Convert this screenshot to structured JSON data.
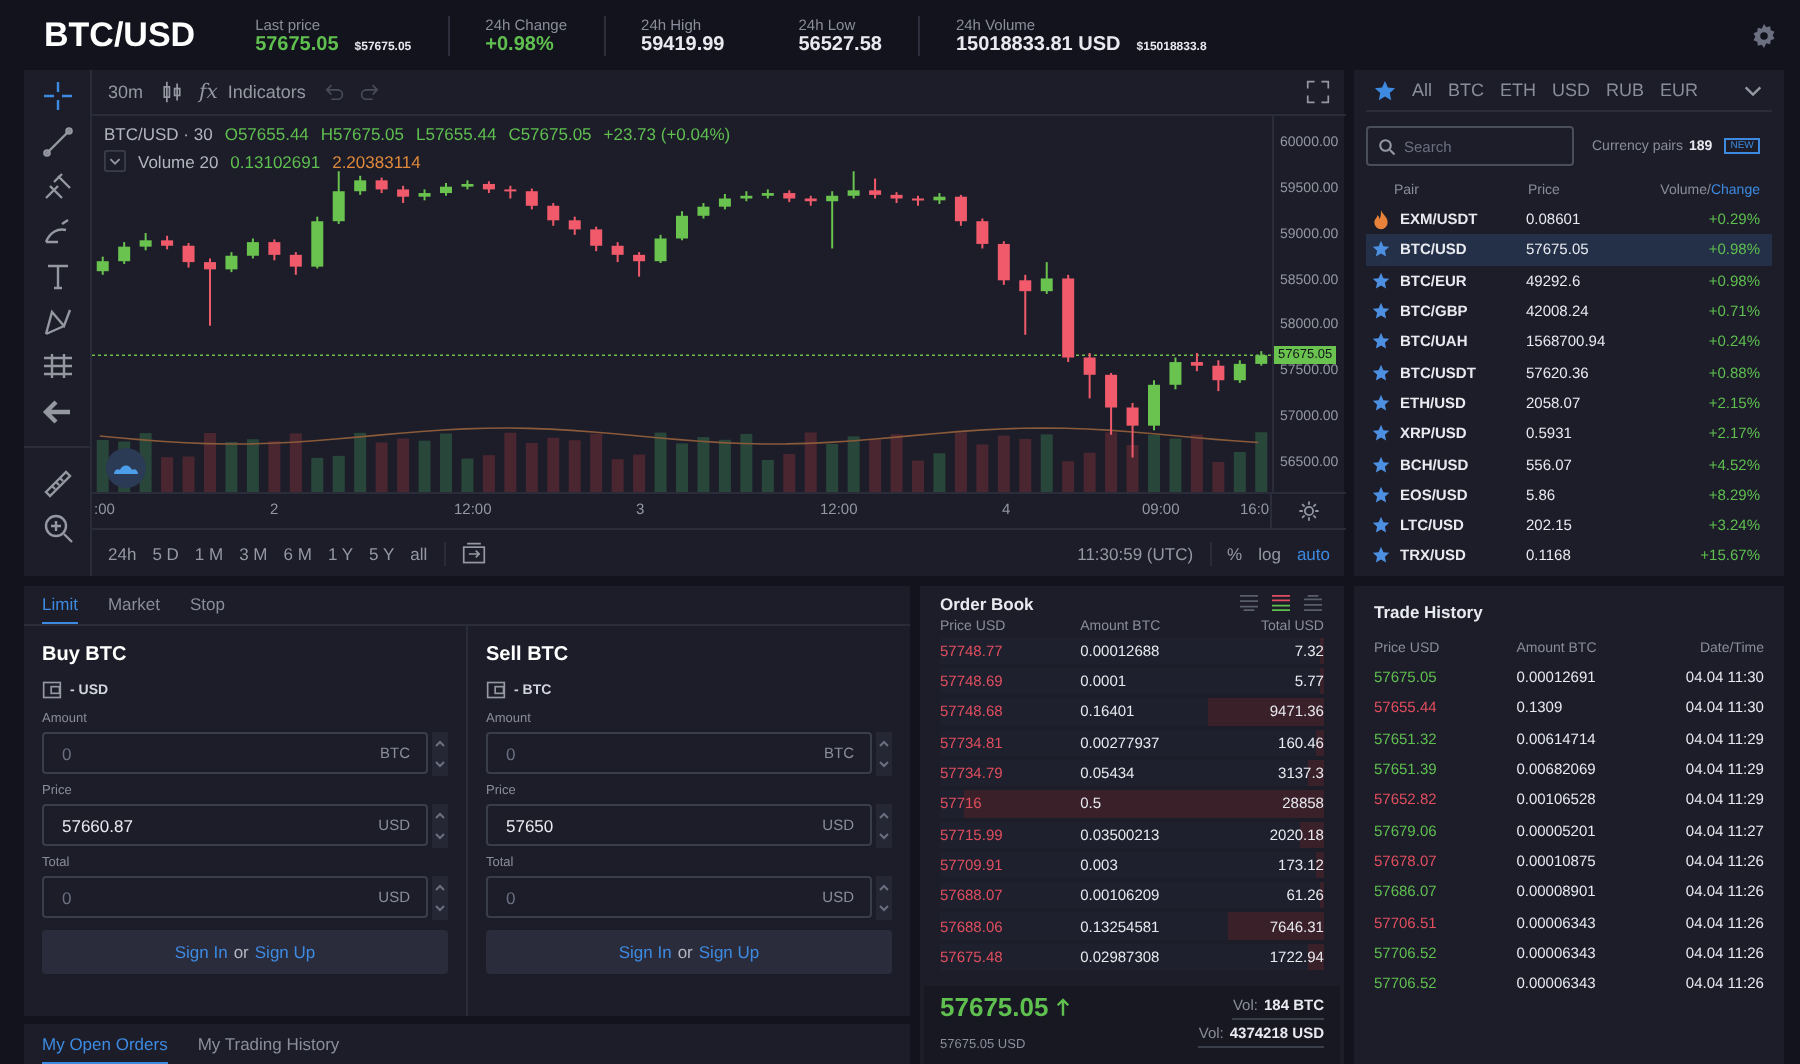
{
  "header": {
    "pair": "BTC/USD",
    "stats": [
      {
        "label": "Last price",
        "value": "57675.05",
        "sub": "$57675.05",
        "color": "#5fbf4f",
        "divider": true
      },
      {
        "label": "24h Change",
        "value": "+0.98%",
        "color": "#5fbf4f",
        "divider": true
      },
      {
        "label": "24h High",
        "value": "59419.99",
        "color": "#e8eaf0",
        "divider": false
      },
      {
        "label": "24h Low",
        "value": "56527.58",
        "color": "#e8eaf0",
        "divider": true
      },
      {
        "label": "24h Volume",
        "value": "15018833.81 USD",
        "sub": "$15018833.8",
        "color": "#e8eaf0",
        "divider": false
      }
    ]
  },
  "chart": {
    "tools": [
      {
        "kind": "crosshair",
        "selected": true
      },
      {
        "kind": "trend-line",
        "selected": false
      },
      {
        "kind": "pitchfork",
        "selected": false
      },
      {
        "kind": "brush",
        "selected": false
      },
      {
        "kind": "text",
        "selected": false
      },
      {
        "kind": "pattern",
        "selected": false
      },
      {
        "kind": "ruler-lines",
        "selected": false
      },
      {
        "kind": "back",
        "selected": false
      },
      {
        "kind": "measure",
        "selected": false
      },
      {
        "kind": "zoom",
        "selected": false
      }
    ],
    "interval": "30m",
    "indicators_icon": "fx",
    "indicators": "Indicators",
    "legend": {
      "symbol": "BTC/USD · 30",
      "values": [
        "O57655.44",
        "H57675.05",
        "L57655.44",
        "C57675.05",
        "+23.73 (+0.04%)"
      ],
      "volume": "Volume 20",
      "volume_values": [
        {
          "text": "0.13102691",
          "color": "#5fbf4f"
        },
        {
          "text": "2.20383114",
          "color": "#e0893a"
        }
      ]
    },
    "last_price_tag": "57675.05",
    "time_axis": [
      ":00",
      "2",
      "12:00",
      "3",
      "12:00",
      "4",
      "09:00",
      "16:0"
    ],
    "chart_data": {
      "type": "candlestick",
      "categories": [
        null,
        null,
        null,
        null,
        null,
        null,
        null,
        null,
        null,
        null,
        null,
        null,
        null,
        null,
        null,
        null,
        null,
        null,
        null,
        null,
        null,
        null,
        null,
        null,
        null,
        null,
        null,
        null,
        null,
        null,
        null,
        null,
        null,
        null,
        null,
        null,
        null,
        null,
        null,
        null,
        null,
        null,
        null,
        null,
        null,
        null,
        null,
        null,
        null,
        null,
        null,
        null,
        null,
        null,
        null
      ],
      "ohlc": [
        [
          58600,
          58760,
          58560,
          58710
        ],
        [
          58710,
          58920,
          58680,
          58870
        ],
        [
          58870,
          59020,
          58830,
          58940
        ],
        [
          58940,
          58990,
          58840,
          58880
        ],
        [
          58880,
          58910,
          58640,
          58700
        ],
        [
          58700,
          58740,
          58000,
          58620
        ],
        [
          58620,
          58810,
          58590,
          58770
        ],
        [
          58770,
          58960,
          58740,
          58920
        ],
        [
          58920,
          58950,
          58720,
          58780
        ],
        [
          58780,
          58810,
          58560,
          58650
        ],
        [
          58650,
          59200,
          58630,
          59150
        ],
        [
          59150,
          59700,
          59120,
          59480
        ],
        [
          59480,
          59650,
          59440,
          59600
        ],
        [
          59600,
          59630,
          59460,
          59500
        ],
        [
          59500,
          59540,
          59350,
          59420
        ],
        [
          59420,
          59500,
          59380,
          59460
        ],
        [
          59460,
          59570,
          59430,
          59530
        ],
        [
          59530,
          59600,
          59500,
          59560
        ],
        [
          59560,
          59590,
          59460,
          59500
        ],
        [
          59500,
          59540,
          59400,
          59480
        ],
        [
          59480,
          59510,
          59280,
          59320
        ],
        [
          59320,
          59350,
          59100,
          59160
        ],
        [
          59160,
          59200,
          59000,
          59060
        ],
        [
          59060,
          59090,
          58820,
          58880
        ],
        [
          58880,
          58920,
          58700,
          58780
        ],
        [
          58780,
          58810,
          58540,
          58710
        ],
        [
          58710,
          59000,
          58690,
          58960
        ],
        [
          58960,
          59260,
          58940,
          59210
        ],
        [
          59210,
          59350,
          59180,
          59310
        ],
        [
          59310,
          59450,
          59280,
          59400
        ],
        [
          59400,
          59480,
          59370,
          59430
        ],
        [
          59430,
          59500,
          59400,
          59460
        ],
        [
          59460,
          59490,
          59360,
          59400
        ],
        [
          59400,
          59430,
          59320,
          59370
        ],
        [
          59370,
          59480,
          58850,
          59430
        ],
        [
          59430,
          59700,
          59400,
          59490
        ],
        [
          59490,
          59620,
          59400,
          59440
        ],
        [
          59440,
          59470,
          59350,
          59400
        ],
        [
          59400,
          59430,
          59320,
          59380
        ],
        [
          59380,
          59460,
          59340,
          59420
        ],
        [
          59420,
          59440,
          59100,
          59150
        ],
        [
          59150,
          59180,
          58850,
          58900
        ],
        [
          58900,
          58930,
          58450,
          58500
        ],
        [
          58500,
          58560,
          57900,
          58380
        ],
        [
          58380,
          58700,
          58350,
          58520
        ],
        [
          58520,
          58560,
          57600,
          57650
        ],
        [
          57650,
          57700,
          57200,
          57460
        ],
        [
          57460,
          57480,
          56800,
          57100
        ],
        [
          57100,
          57150,
          56550,
          56900
        ],
        [
          56900,
          57400,
          56850,
          57350
        ],
        [
          57350,
          57650,
          57300,
          57600
        ],
        [
          57600,
          57700,
          57500,
          57560
        ],
        [
          57560,
          57620,
          57280,
          57400
        ],
        [
          57400,
          57620,
          57370,
          57580
        ],
        [
          57580,
          57720,
          57560,
          57675.05
        ]
      ],
      "ylim": [
        56170,
        60308
      ],
      "ref_lines": [
        {
          "axis": "y",
          "value": 57675.05
        }
      ],
      "yticks": [
        {
          "value": 60000,
          "label": "60000.00"
        },
        {
          "value": 59500,
          "label": "59500.00"
        },
        {
          "value": 59000,
          "label": "59000.00"
        },
        {
          "value": 58500,
          "label": "58500.00"
        },
        {
          "value": 58000,
          "label": "58000.00"
        },
        {
          "value": 57500,
          "label": "57500.00"
        },
        {
          "value": 57000,
          "label": "57000.00"
        },
        {
          "value": 56500,
          "label": "56500.00"
        }
      ]
    },
    "ranges": [
      "24h",
      "5 D",
      "1 M",
      "3 M",
      "6 M",
      "1 Y",
      "5 Y",
      "all"
    ],
    "clock": "11:30:59 (UTC)",
    "scales": [
      {
        "label": "%",
        "selected": false
      },
      {
        "label": "log",
        "selected": false
      },
      {
        "label": "auto",
        "selected": true
      }
    ]
  },
  "markets": {
    "favorites_selected": true,
    "tabs": [
      {
        "label": "All",
        "selected": false
      },
      {
        "label": "BTC",
        "selected": false
      },
      {
        "label": "ETH",
        "selected": false
      },
      {
        "label": "USD",
        "selected": false
      },
      {
        "label": "RUB",
        "selected": false
      },
      {
        "label": "EUR",
        "selected": false
      }
    ],
    "search": {
      "placeholder": "Search"
    },
    "pairs_label": "Currency pairs",
    "pairs_count": "189",
    "new_badge": "NEW",
    "columns": {
      "pair": "Pair",
      "price": "Price",
      "change": [
        {
          "label": "Volume/",
          "selected": false
        },
        {
          "label": "Change",
          "selected": true
        }
      ]
    },
    "rows": [
      {
        "kind": "hot",
        "pair": "EXM/USDT",
        "price": "0.08601",
        "change": "+0.29%",
        "selected": false
      },
      {
        "kind": "star",
        "pair": "BTC/USD",
        "price": "57675.05",
        "change": "+0.98%",
        "selected": true
      },
      {
        "kind": "star",
        "pair": "BTC/EUR",
        "price": "49292.6",
        "change": "+0.98%",
        "selected": false
      },
      {
        "kind": "star",
        "pair": "BTC/GBP",
        "price": "42008.24",
        "change": "+0.71%",
        "selected": false
      },
      {
        "kind": "star",
        "pair": "BTC/UAH",
        "price": "1568700.94",
        "change": "+0.24%",
        "selected": false
      },
      {
        "kind": "star",
        "pair": "BTC/USDT",
        "price": "57620.36",
        "change": "+0.88%",
        "selected": false
      },
      {
        "kind": "star",
        "pair": "ETH/USD",
        "price": "2058.07",
        "change": "+2.15%",
        "selected": false
      },
      {
        "kind": "star",
        "pair": "XRP/USD",
        "price": "0.5931",
        "change": "+2.17%",
        "selected": false
      },
      {
        "kind": "star",
        "pair": "BCH/USD",
        "price": "556.07",
        "change": "+4.52%",
        "selected": false
      },
      {
        "kind": "star",
        "pair": "EOS/USD",
        "price": "5.86",
        "change": "+8.29%",
        "selected": false
      },
      {
        "kind": "star",
        "pair": "LTC/USD",
        "price": "202.15",
        "change": "+3.24%",
        "selected": false
      },
      {
        "kind": "star",
        "pair": "TRX/USD",
        "price": "0.1168",
        "change": "+15.67%",
        "selected": false
      }
    ]
  },
  "order_form": {
    "tabs": [
      {
        "label": "Limit",
        "selected": true
      },
      {
        "label": "Market",
        "selected": false
      },
      {
        "label": "Stop",
        "selected": false
      }
    ],
    "sides": [
      {
        "title": "Buy BTC",
        "balance": "- USD",
        "fields": [
          {
            "label": "Amount",
            "placeholder": "0",
            "unit": "BTC"
          },
          {
            "label": "Price",
            "value": "57660.87",
            "unit": "USD"
          },
          {
            "label": "Total",
            "placeholder": "0",
            "unit": "USD"
          }
        ],
        "sign_in": "Sign In",
        "or": "or",
        "sign_up": "Sign Up"
      },
      {
        "title": "Sell BTC",
        "balance": "- BTC",
        "fields": [
          {
            "label": "Amount",
            "placeholder": "0",
            "unit": "BTC"
          },
          {
            "label": "Price",
            "value": "57650",
            "unit": "USD"
          },
          {
            "label": "Total",
            "placeholder": "0",
            "unit": "USD"
          }
        ],
        "sign_in": "Sign In",
        "or": "or",
        "sign_up": "Sign Up"
      }
    ]
  },
  "orders_tabs": [
    {
      "label": "My Open Orders",
      "selected": true
    },
    {
      "label": "My Trading History",
      "selected": false
    }
  ],
  "order_book": {
    "title": "Order Book",
    "view_modes": [
      {
        "kind": "asks",
        "selected": false
      },
      {
        "kind": "both",
        "selected": true
      },
      {
        "kind": "bids",
        "selected": false
      }
    ],
    "columns": [
      "Price USD",
      "Amount BTC",
      "Total USD"
    ],
    "rows": [
      {
        "price": "57748.77",
        "amount": "0.00012688",
        "total": "7.32",
        "level": 0.01
      },
      {
        "price": "57748.69",
        "amount": "0.0001",
        "total": "5.77",
        "level": 0.01
      },
      {
        "price": "57748.68",
        "amount": "0.16401",
        "total": "9471.36",
        "level": 0.3
      },
      {
        "price": "57734.81",
        "amount": "0.00277937",
        "total": "160.46",
        "level": 0.02
      },
      {
        "price": "57734.79",
        "amount": "0.05434",
        "total": "3137.3",
        "level": 0.04
      },
      {
        "price": "57716",
        "amount": "0.5",
        "total": "28858",
        "level": 0.94
      },
      {
        "price": "57715.99",
        "amount": "0.03500213",
        "total": "2020.18",
        "level": 0.06
      },
      {
        "price": "57709.91",
        "amount": "0.003",
        "total": "173.12",
        "level": 0.02
      },
      {
        "price": "57688.07",
        "amount": "0.00106209",
        "total": "61.26",
        "level": 0.01
      },
      {
        "price": "57688.06",
        "amount": "0.13254581",
        "total": "7646.31",
        "level": 0.25
      },
      {
        "price": "57675.48",
        "amount": "0.02987308",
        "total": "1722.94",
        "level": 0.04
      }
    ],
    "last": "57675.05",
    "last_rising": true,
    "last_usd": "57675.05 USD",
    "volumes": [
      {
        "label": "Vol:",
        "value": "184 BTC"
      },
      {
        "label": "Vol:",
        "value": "4374218 USD"
      }
    ]
  },
  "trade_history": {
    "title": "Trade History",
    "columns": [
      "Price USD",
      "Amount BTC",
      "Date/Time"
    ],
    "rows": [
      {
        "color": "#5fbf4f",
        "price": "57675.05",
        "amount": "0.00012691",
        "time": "04.04 11:30"
      },
      {
        "color": "#e04e5f",
        "price": "57655.44",
        "amount": "0.1309",
        "time": "04.04 11:30"
      },
      {
        "color": "#5fbf4f",
        "price": "57651.32",
        "amount": "0.00614714",
        "time": "04.04 11:29"
      },
      {
        "color": "#5fbf4f",
        "price": "57651.39",
        "amount": "0.00682069",
        "time": "04.04 11:29"
      },
      {
        "color": "#e04e5f",
        "price": "57652.82",
        "amount": "0.00106528",
        "time": "04.04 11:29"
      },
      {
        "color": "#5fbf4f",
        "price": "57679.06",
        "amount": "0.00005201",
        "time": "04.04 11:27"
      },
      {
        "color": "#e04e5f",
        "price": "57678.07",
        "amount": "0.00010875",
        "time": "04.04 11:26"
      },
      {
        "color": "#5fbf4f",
        "price": "57686.07",
        "amount": "0.00008901",
        "time": "04.04 11:26"
      },
      {
        "color": "#e04e5f",
        "price": "57706.51",
        "amount": "0.00006343",
        "time": "04.04 11:26"
      },
      {
        "color": "#5fbf4f",
        "price": "57706.52",
        "amount": "0.00006343",
        "time": "04.04 11:26"
      },
      {
        "color": "#5fbf4f",
        "price": "57706.52",
        "amount": "0.00006343",
        "time": "04.04 11:26"
      }
    ]
  }
}
